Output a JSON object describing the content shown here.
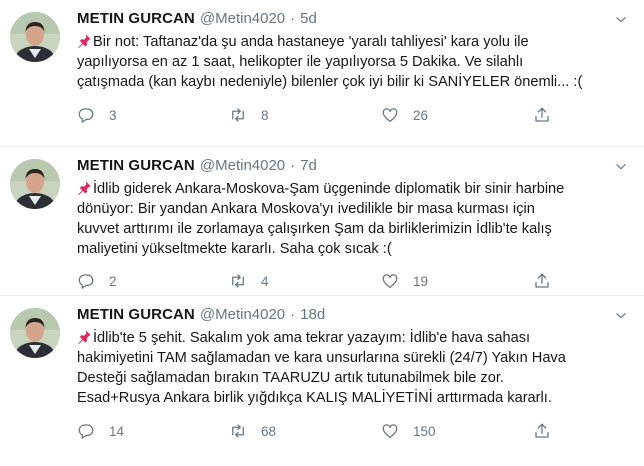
{
  "tweets": [
    {
      "name": "METIN GURCAN",
      "handle": "@Metin4020",
      "separator": "·",
      "time": "5d",
      "lines": [
        "Bir not: Taftanaz'da şu anda hastaneye 'yaralı tahliyesi' kara yolu ile",
        "yapılıyorsa en az 1 saat, helikopter ile yapılıyorsa 5 Dakika. Ve silahlı",
        "çatışmada (kan kaybı nedeniyle) bilenler çok iyi bilir ki SANİYELER önemli... :("
      ],
      "replies": "3",
      "retweets": "8",
      "likes": "26"
    },
    {
      "name": "METIN GURCAN",
      "handle": "@Metin4020",
      "separator": "·",
      "time": "7d",
      "lines": [
        "İdlib giderek Ankara-Moskova-Şam üçgeninde diplomatik bir sinir harbine",
        "dönüyor: Bir yandan Ankara Moskova'yı ivedilikle bir masa kurması için",
        "kuvvet arttırımı ile zorlamaya çalışırken Şam da birliklerimizin İdlib'te kalış",
        "maliyetini yükseltmekte kararlı. Saha çok sıcak :("
      ],
      "replies": "2",
      "retweets": "4",
      "likes": "19"
    },
    {
      "name": "METIN GURCAN",
      "handle": "@Metin4020",
      "separator": "·",
      "time": "18d",
      "lines": [
        "İdlib'te 5 şehit. Sakalım yok ama tekrar yazayım: İdlib'e hava sahası",
        "hakimiyetini TAM sağlamadan ve kara unsurlarına sürekli (24/7) Yakın Hava",
        "Desteği sağlamadan bırakın TAARUZU artık tutunabilmek bile zor.",
        "Esad+Rusya Ankara birlik yığdıkça KALIŞ MALİYETİNİ arttırmada kararlı."
      ],
      "replies": "14",
      "retweets": "68",
      "likes": "150"
    }
  ],
  "colors": {
    "text": "#14171a",
    "secondary": "#657786",
    "divider": "#e6ecf0",
    "pin": "#e0245e"
  },
  "icons": {
    "reply": "reply-icon",
    "retweet": "retweet-icon",
    "like": "like-icon",
    "share": "share-icon",
    "pin": "pushpin-icon",
    "caret": "chevron-down-icon"
  }
}
